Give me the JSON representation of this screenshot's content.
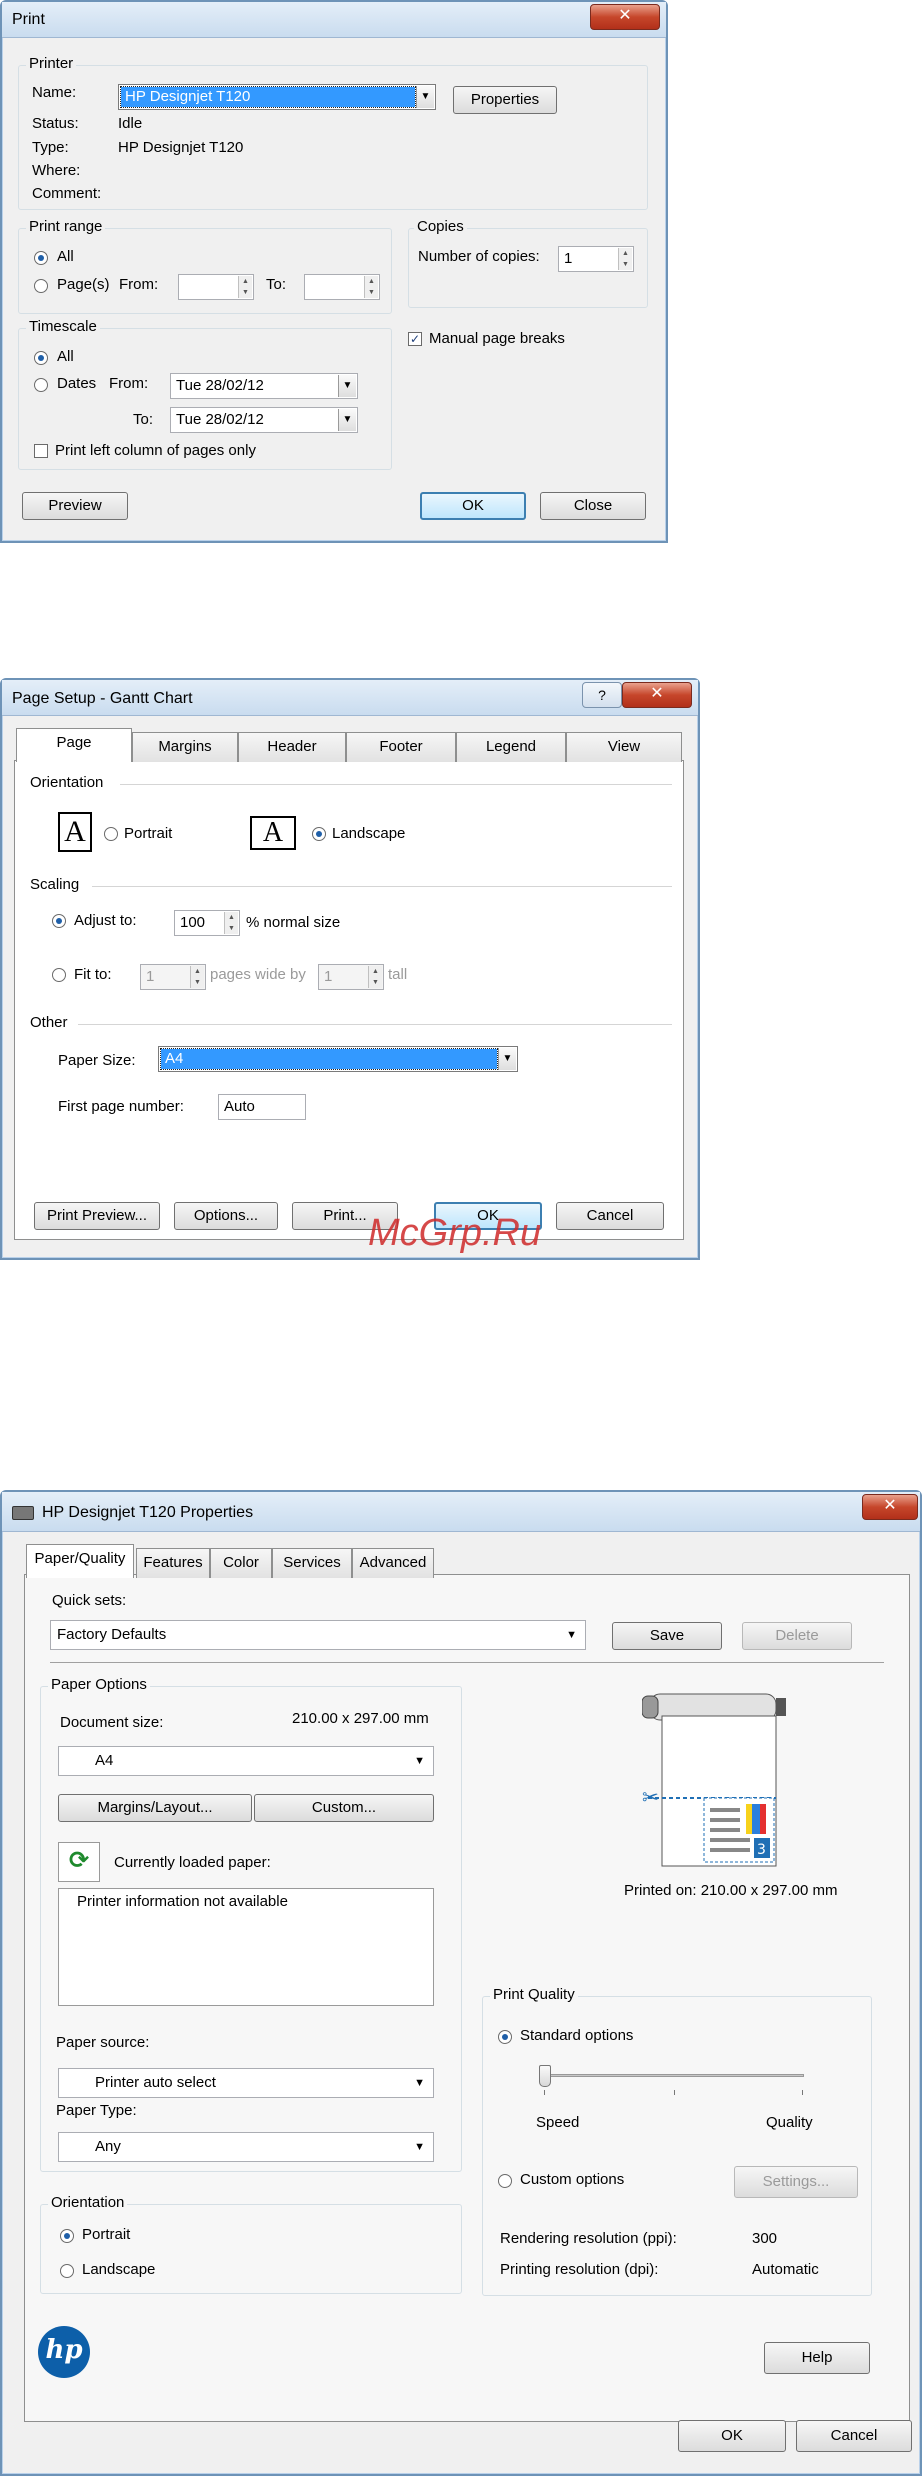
{
  "print_dialog": {
    "title": "Print",
    "close": "✕",
    "printer": {
      "group": "Printer",
      "name_label": "Name:",
      "name_value": "HP Designjet T120",
      "properties_button": "Properties",
      "status_label": "Status:",
      "status_value": "Idle",
      "type_label": "Type:",
      "type_value": "HP Designjet T120",
      "where_label": "Where:",
      "comment_label": "Comment:"
    },
    "print_range": {
      "group": "Print range",
      "all": "All",
      "pages": "Page(s)",
      "from": "From:",
      "to": "To:"
    },
    "copies": {
      "group": "Copies",
      "number_label": "Number of copies:",
      "number_value": "1"
    },
    "manual_page_breaks": "Manual page breaks",
    "timescale": {
      "group": "Timescale",
      "all": "All",
      "dates": "Dates",
      "from": "From:",
      "from_value": "Tue 28/02/12",
      "to": "To:",
      "to_value": "Tue 28/02/12",
      "left_column": "Print left column of pages only"
    },
    "buttons": {
      "preview": "Preview",
      "ok": "OK",
      "close": "Close"
    }
  },
  "page_setup": {
    "title": "Page Setup - Gantt Chart",
    "help": "?",
    "close": "✕",
    "tabs": [
      "Page",
      "Margins",
      "Header",
      "Footer",
      "Legend",
      "View"
    ],
    "orientation": {
      "group": "Orientation",
      "portrait": "Portrait",
      "landscape": "Landscape",
      "icon_letter": "A"
    },
    "scaling": {
      "group": "Scaling",
      "adjust_to": "Adjust to:",
      "adjust_value": "100",
      "normal_size": "% normal size",
      "fit_to": "Fit to:",
      "wide_value": "1",
      "pages_wide_by": "pages wide by",
      "tall_value": "1",
      "tall": "tall"
    },
    "other": {
      "group": "Other",
      "paper_size_label": "Paper Size:",
      "paper_size_value": "A4",
      "first_page_label": "First page number:",
      "first_page_value": "Auto"
    },
    "buttons": {
      "print_preview": "Print Preview...",
      "options": "Options...",
      "print": "Print...",
      "ok": "OK",
      "cancel": "Cancel"
    }
  },
  "watermark": "McGrp.Ru",
  "properties": {
    "title": "HP Designjet T120 Properties",
    "close": "✕",
    "tabs": [
      "Paper/Quality",
      "Features",
      "Color",
      "Services",
      "Advanced"
    ],
    "quick_sets": {
      "label": "Quick sets:",
      "value": "Factory Defaults",
      "save": "Save",
      "delete": "Delete"
    },
    "paper_options": {
      "group": "Paper Options",
      "document_size_label": "Document size:",
      "document_size_value": "210.00 x 297.00 mm",
      "size_select": "A4",
      "margins_button": "Margins/Layout...",
      "custom_button": "Custom...",
      "loaded_paper_label": "Currently loaded paper:",
      "loaded_paper_info": "Printer information not available",
      "paper_source_label": "Paper source:",
      "paper_source_value": "Printer auto select",
      "paper_type_label": "Paper Type:",
      "paper_type_value": "Any"
    },
    "orientation": {
      "group": "Orientation",
      "portrait": "Portrait",
      "landscape": "Landscape"
    },
    "preview": {
      "printed_on": "Printed on: 210.00 x 297.00 mm"
    },
    "print_quality": {
      "group": "Print Quality",
      "standard": "Standard options",
      "speed": "Speed",
      "quality": "Quality",
      "slider_level": 0,
      "custom": "Custom options",
      "settings": "Settings...",
      "rendering_label": "Rendering resolution (ppi):",
      "rendering_value": "300",
      "printing_label": "Printing resolution (dpi):",
      "printing_value": "Automatic"
    },
    "logo": "hp",
    "buttons": {
      "help": "Help",
      "ok": "OK",
      "cancel": "Cancel"
    },
    "colors": {
      "accent": "#1f6fb5",
      "hp_blue": "#0d5fa9"
    }
  }
}
